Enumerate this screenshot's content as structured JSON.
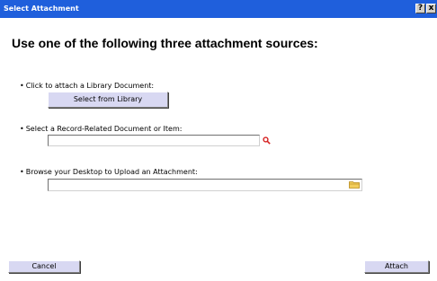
{
  "window": {
    "title": "Select Attachment",
    "help_glyph": "?",
    "close_glyph": "x"
  },
  "heading": "Use one of the following three attachment sources:",
  "library": {
    "label": "Click to attach a Library Document:",
    "button": "Select from Library"
  },
  "record": {
    "label": "Select a Record-Related Document or Item:",
    "value": "",
    "icon": "search-icon"
  },
  "desktop": {
    "label": "Browse your Desktop to Upload an Attachment:",
    "value": "",
    "icon": "folder-icon"
  },
  "footer": {
    "cancel": "Cancel",
    "attach": "Attach"
  },
  "colors": {
    "titlebar": "#1f5fdc",
    "button": "#d8d8f2",
    "search_icon": "#d62020",
    "folder_icon": "#e8b430"
  }
}
